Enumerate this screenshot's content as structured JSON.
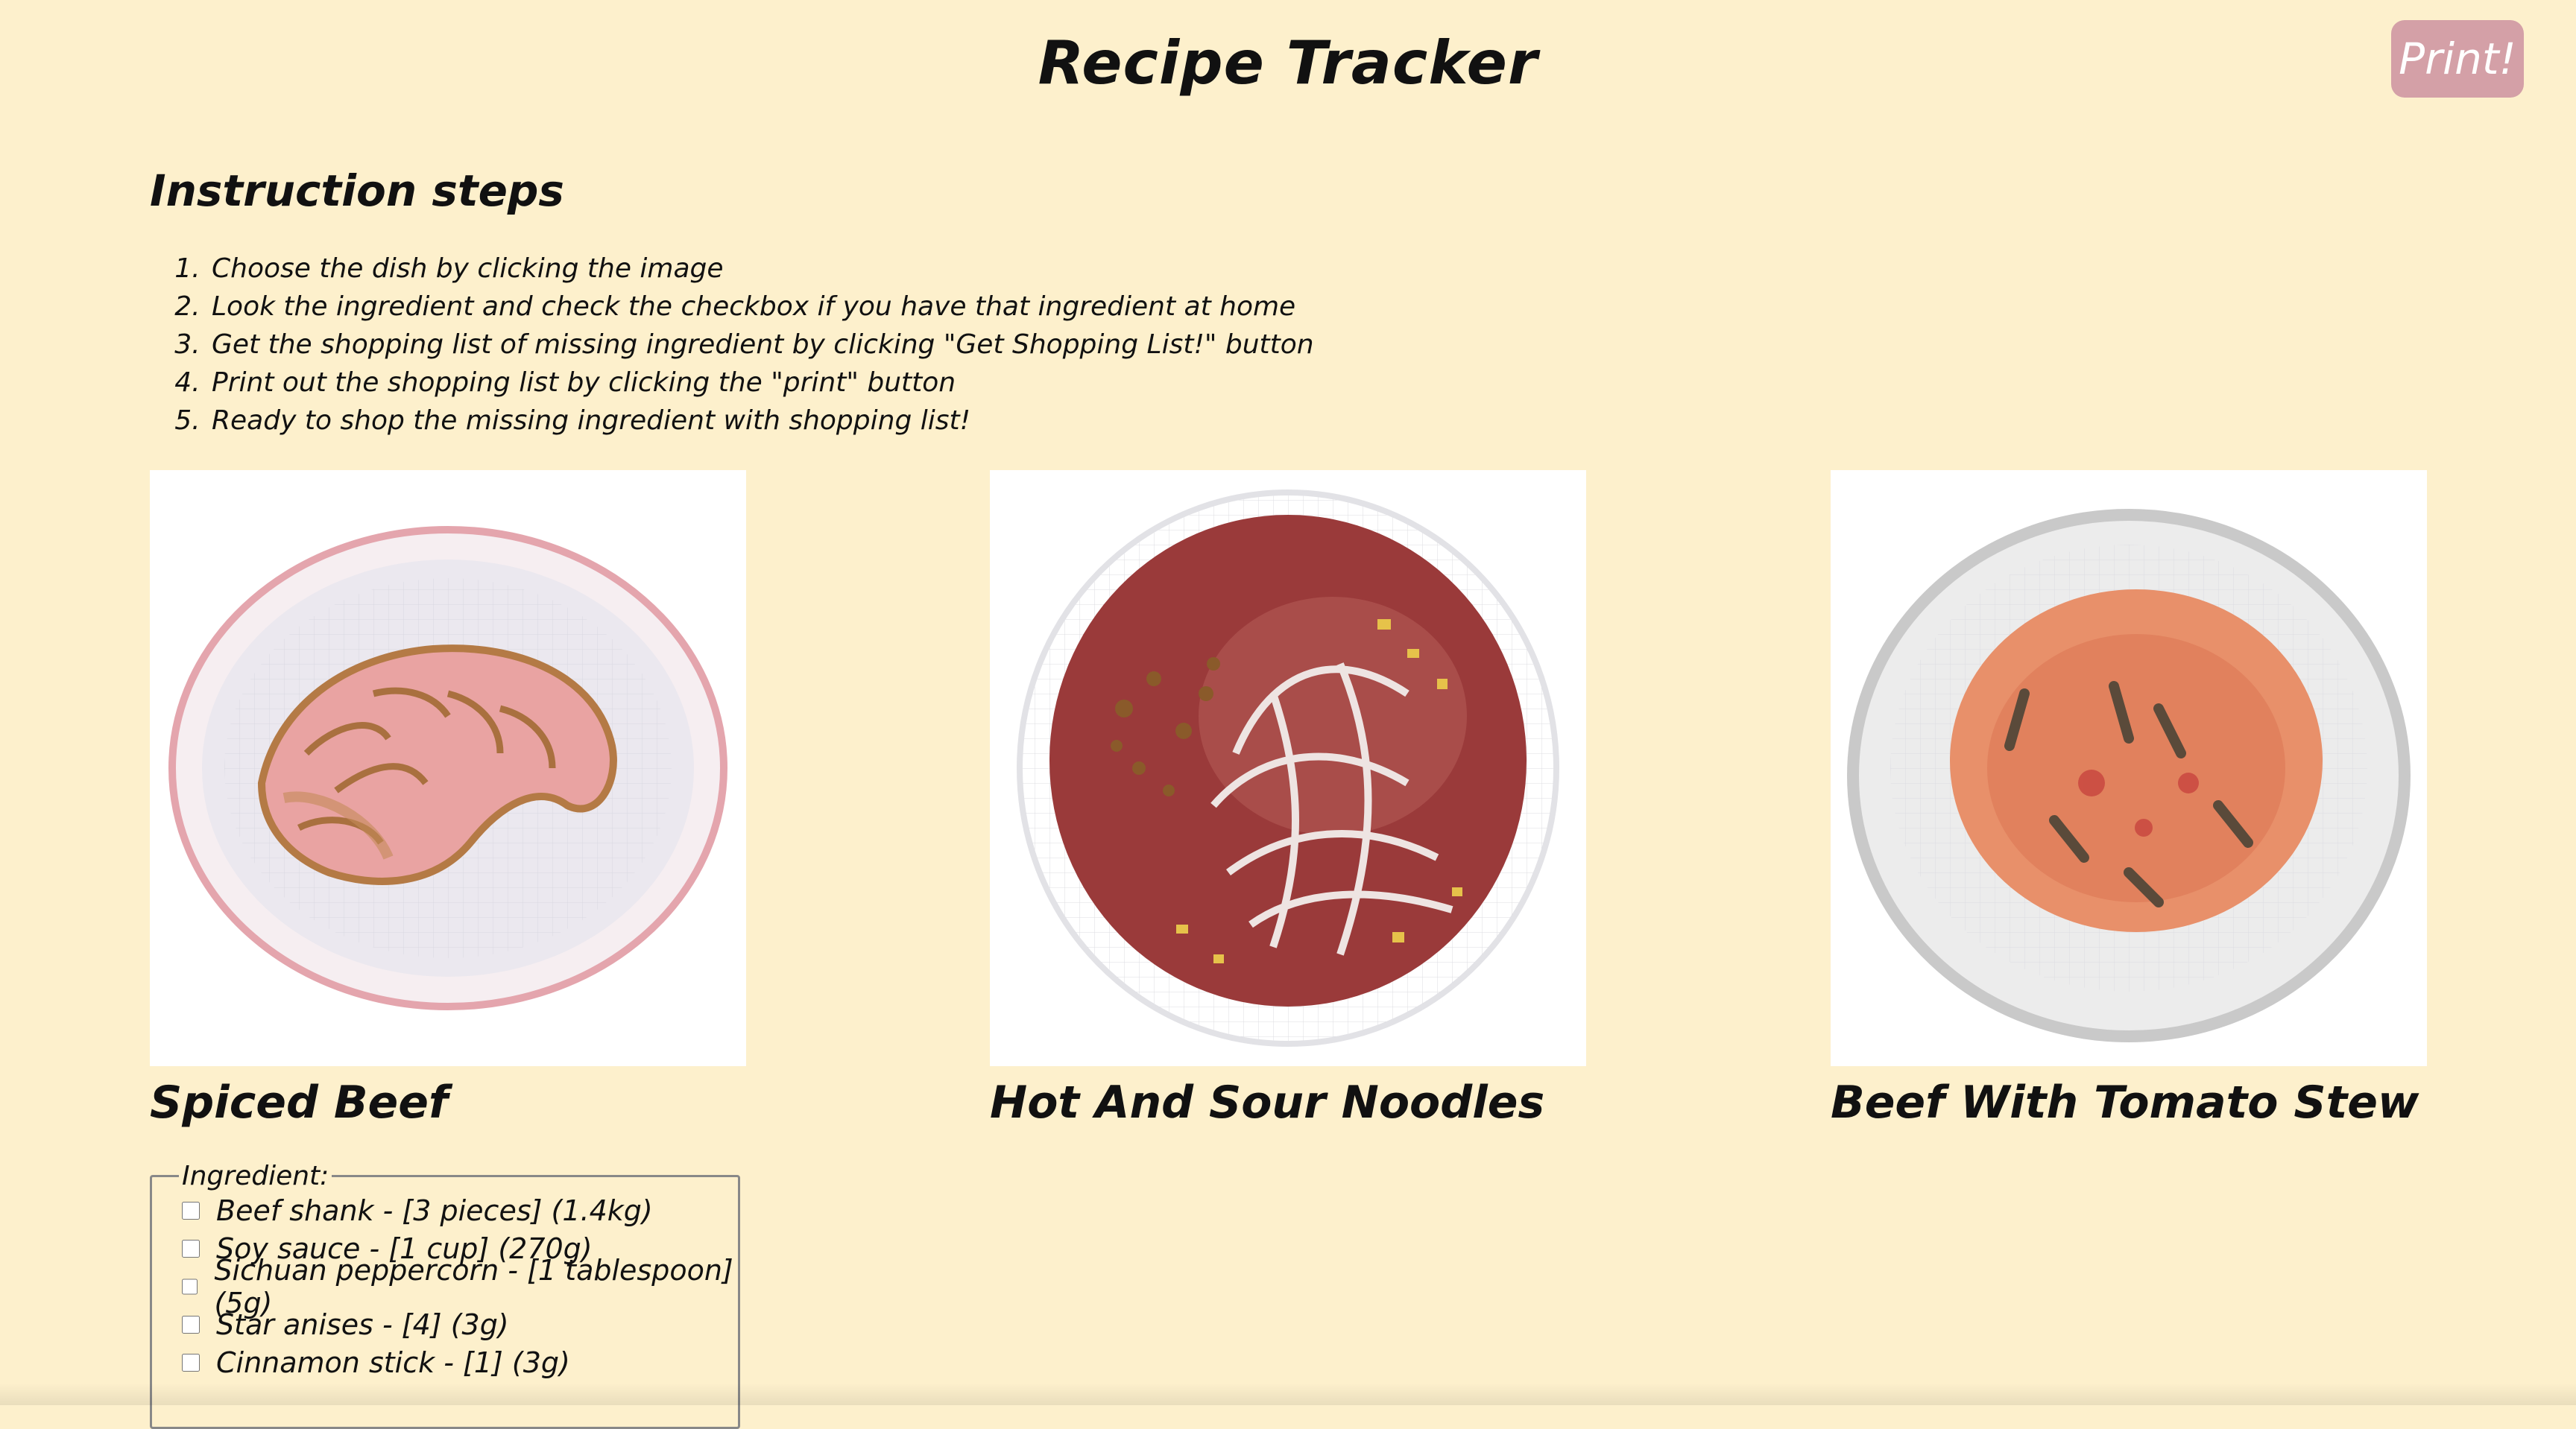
{
  "header": {
    "title": "Recipe Tracker",
    "print_label": "Print!"
  },
  "instructions": {
    "heading": "Instruction steps",
    "steps": [
      "Choose the dish by clicking the image",
      "Look the ingredient and check the checkbox if you have that ingredient at home",
      "Get the shopping list of missing ingredient by clicking \"Get Shopping List!\" button",
      "Print out the shopping list by clicking the \"print\" button",
      "Ready to shop the missing ingredient with shopping list!"
    ]
  },
  "dishes": [
    {
      "name": "Spiced Beef",
      "illustration": "spiced-beef-watercolor"
    },
    {
      "name": "Hot And Sour Noodles",
      "illustration": "hot-and-sour-noodles-watercolor"
    },
    {
      "name": "Beef With Tomato Stew",
      "illustration": "beef-tomato-stew-watercolor"
    }
  ],
  "ingredients": {
    "legend": "Ingredient:",
    "items": [
      {
        "label": "Beef shank - [3 pieces] (1.4kg)",
        "checked": false
      },
      {
        "label": "Soy sauce - [1 cup] (270g)",
        "checked": false
      },
      {
        "label": "Sichuan peppercorn - [1 tablespoon] (5g)",
        "checked": false
      },
      {
        "label": "Star anises - [4] (3g)",
        "checked": false
      },
      {
        "label": "Cinnamon stick - [1] (3g)",
        "checked": false
      }
    ]
  },
  "colors": {
    "background": "#fdf0cc",
    "print_button": "#d4a0a7"
  }
}
